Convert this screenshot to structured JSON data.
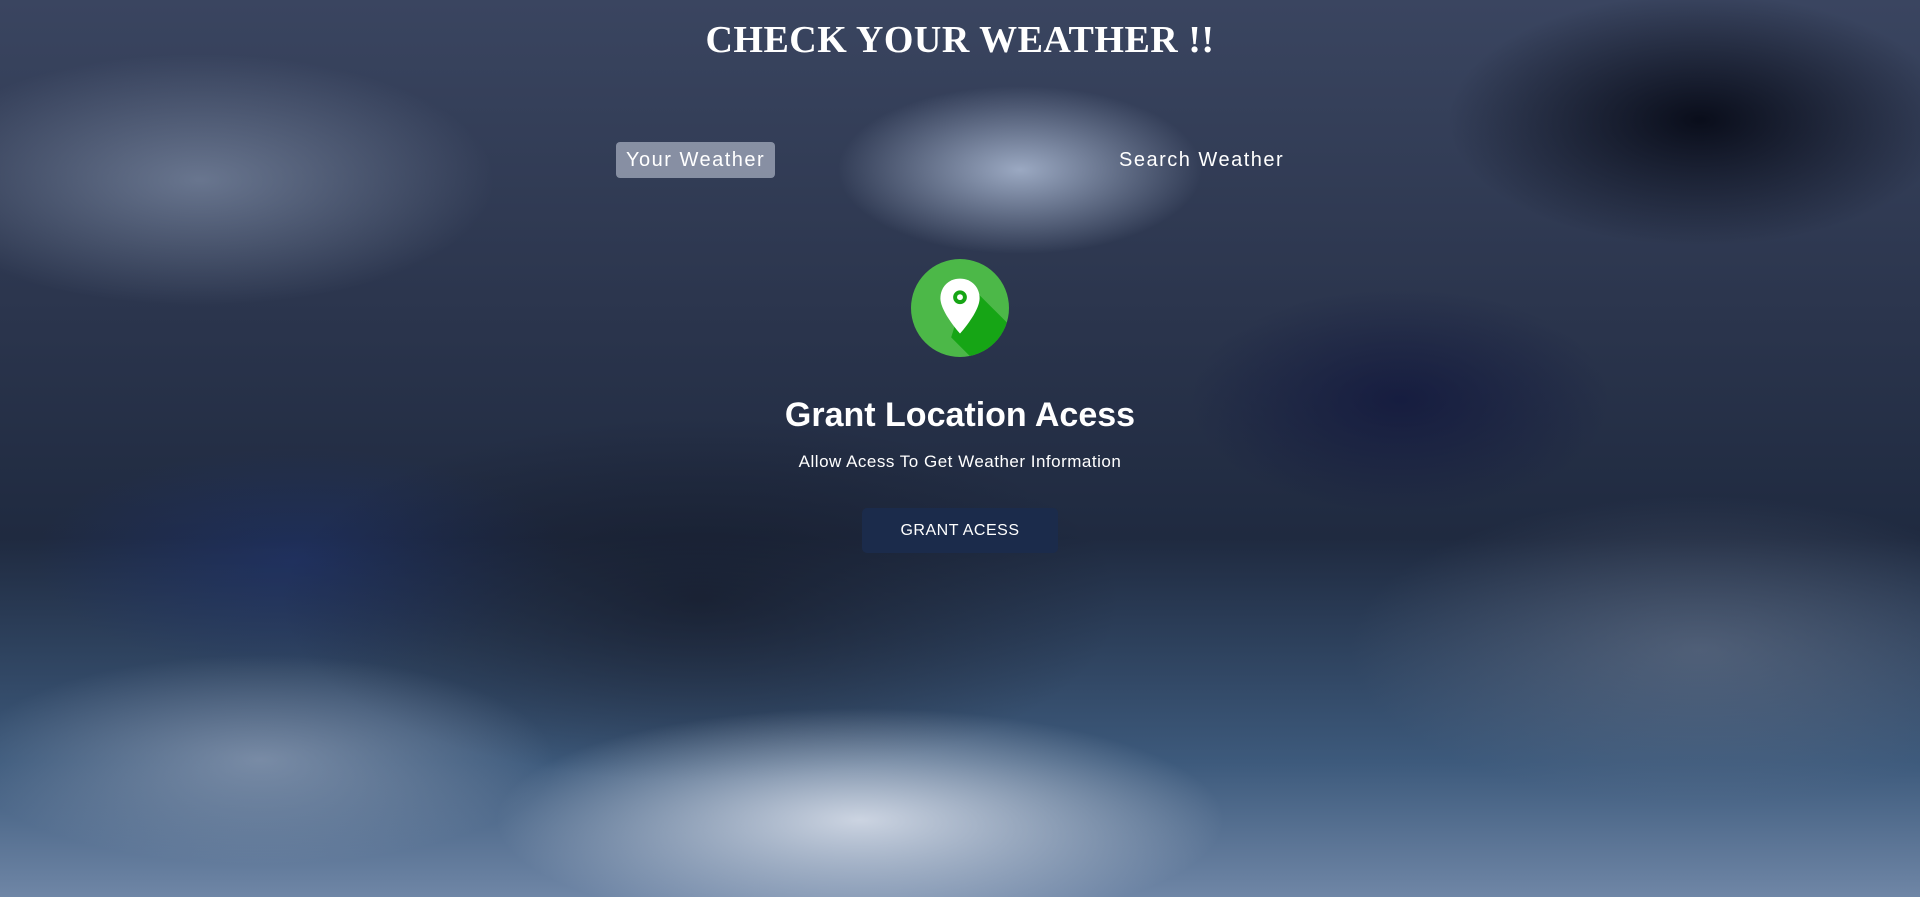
{
  "header": {
    "title": "CHECK YOUR WEATHER !!"
  },
  "tabs": [
    {
      "label": "Your Weather",
      "active": true
    },
    {
      "label": "Search Weather",
      "active": false
    }
  ],
  "grant_location": {
    "icon": "location-pin-icon",
    "heading": "Grant Location Acess",
    "subtext": "Allow Acess To Get Weather Information",
    "button_label": "GRANT ACESS"
  },
  "colors": {
    "button_bg": "#1b2b4b",
    "icon_green": "#4cb848",
    "icon_green_dark": "#16a515",
    "active_tab_bg": "#dbe2ef"
  }
}
